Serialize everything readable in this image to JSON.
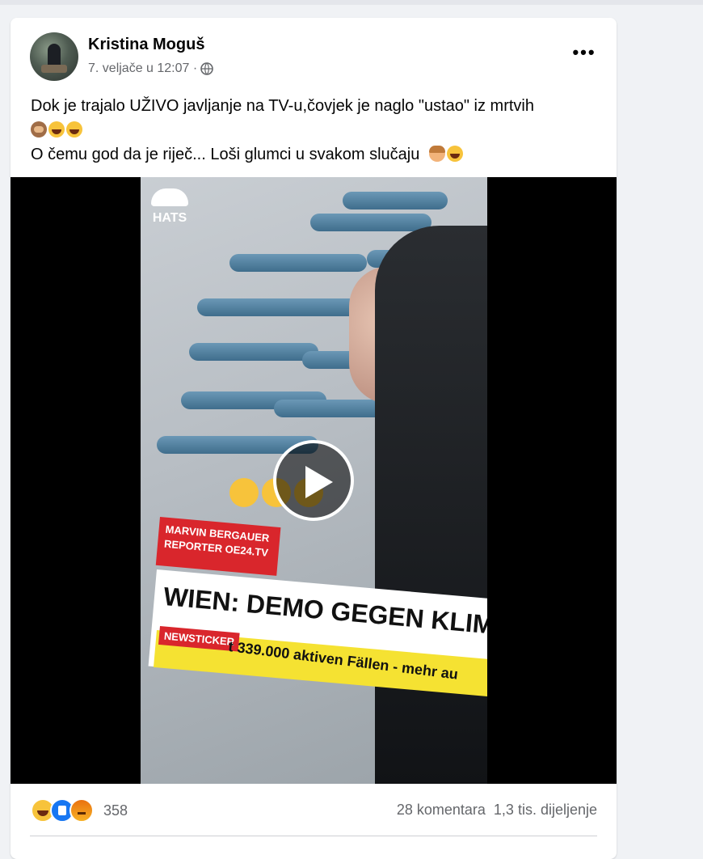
{
  "post": {
    "author": "Kristina Moguš",
    "date": "7. veljače u 12:07 ·",
    "text_line1": "Dok je trajalo UŽIVO javljanje na TV-u,čovjek je naglo \"ustao\" iz mrtvih",
    "text_line3": "O čemu god da je riječ... Loši glumci u svakom slučaju"
  },
  "video": {
    "logo_text": "HATS",
    "name_tag_name": "MARVIN BERGAUER",
    "name_tag_role": "REPORTER OE24.TV",
    "headline": "WIEN: DEMO GEGEN KLIMAP",
    "ticker_label": "NEWSTICKER",
    "ticker_text": "t 339.000 aktiven Fällen - mehr au"
  },
  "footer": {
    "reaction_count": "358",
    "comments": "28 komentara",
    "shares": "1,3 tis. dijeljenje"
  },
  "colors": {
    "accent": "#1877f2",
    "text": "#050505",
    "secondary": "#65676b",
    "background": "#f0f2f5"
  }
}
